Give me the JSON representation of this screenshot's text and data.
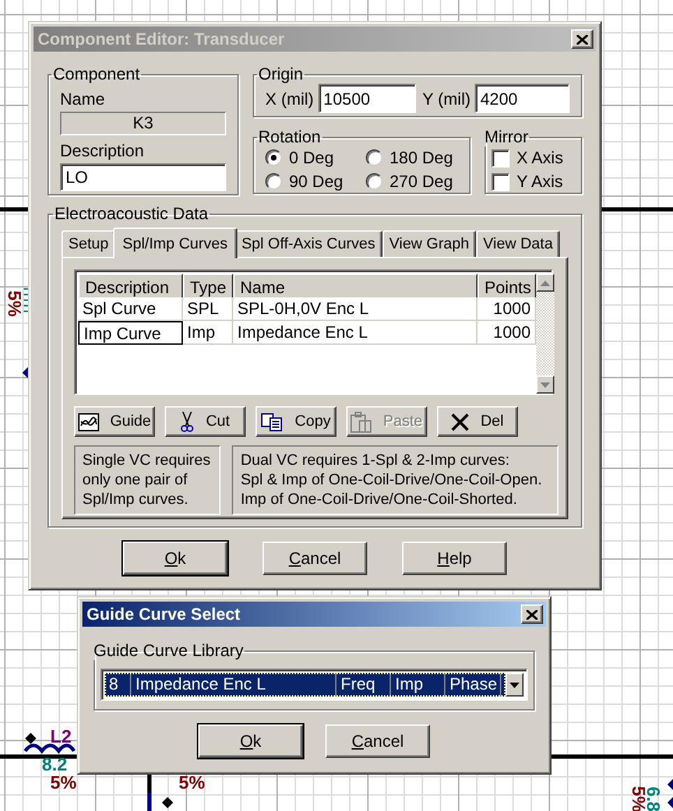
{
  "canvas": {
    "labels": [
      {
        "text": "5%",
        "kind": "vertical",
        "color": "#800000"
      },
      {
        "text": "L2",
        "kind": "part",
        "color": "#800080"
      },
      {
        "text": "8.2",
        "kind": "value",
        "color": "#008080"
      },
      {
        "text": "5%",
        "kind": "tolerance",
        "color": "#800000"
      },
      {
        "text": "5%",
        "kind": "tolerance2",
        "color": "#800000"
      },
      {
        "text": "5%",
        "kind": "vertical-right",
        "color": "#800000"
      },
      {
        "text": "6.8",
        "kind": "vertical-right2",
        "color": "#008080"
      }
    ]
  },
  "editor": {
    "title": "Component Editor: Transducer",
    "active": false,
    "component": {
      "legend": "Component",
      "name_label": "Name",
      "name_value": "K3",
      "description_label": "Description",
      "description_value": "LO"
    },
    "origin": {
      "legend": "Origin",
      "x_label": "X (mil)",
      "x_value": "10500",
      "y_label": "Y (mil)",
      "y_value": "4200"
    },
    "rotation": {
      "legend": "Rotation",
      "options": [
        {
          "label": "0 Deg",
          "selected": true
        },
        {
          "label": "180 Deg",
          "selected": false
        },
        {
          "label": "90 Deg",
          "selected": false
        },
        {
          "label": "270 Deg",
          "selected": false
        }
      ]
    },
    "mirror": {
      "legend": "Mirror",
      "options": [
        {
          "label": "X Axis",
          "checked": false
        },
        {
          "label": "Y Axis",
          "checked": false
        }
      ]
    },
    "data": {
      "legend": "Electroacoustic Data",
      "tabs": [
        {
          "label": "Setup",
          "selected": false
        },
        {
          "label": "Spl/Imp Curves",
          "selected": true
        },
        {
          "label": "Spl Off-Axis Curves",
          "selected": false
        },
        {
          "label": "View Graph",
          "selected": false
        },
        {
          "label": "View Data",
          "selected": false
        }
      ],
      "table": {
        "columns": [
          "Description",
          "Type",
          "Name",
          "Points"
        ],
        "rows": [
          {
            "cells": [
              "Spl Curve",
              "SPL",
              "SPL-0H,0V Enc L",
              "1000"
            ],
            "focused": false
          },
          {
            "cells": [
              "Imp Curve",
              "Imp",
              "Impedance Enc L",
              "1000"
            ],
            "focused": true
          }
        ]
      },
      "tools": [
        {
          "label": "Guide",
          "kind": "guide",
          "disabled": false
        },
        {
          "label": "Cut",
          "kind": "cut",
          "disabled": false
        },
        {
          "label": "Copy",
          "kind": "copy",
          "disabled": false
        },
        {
          "label": "Paste",
          "kind": "paste",
          "disabled": true
        },
        {
          "label": "Del",
          "kind": "delete",
          "disabled": false
        }
      ],
      "notes": [
        "Single VC requires\nonly one pair of\nSpl/Imp curves.",
        "Dual VC requires 1-Spl & 2-Imp curves:\nSpl & Imp of One-Coil-Drive/One-Coil-Open.\nImp of One-Coil-Drive/One-Coil-Shorted."
      ]
    },
    "buttons": [
      {
        "label": "Ok",
        "default": true
      },
      {
        "label": "Cancel",
        "default": false
      },
      {
        "label": "Help",
        "default": false
      }
    ]
  },
  "guide": {
    "title": "Guide Curve Select",
    "active": true,
    "legend": "Guide Curve Library",
    "selection": [
      "8",
      "Impedance Enc L",
      "Freq",
      "Imp",
      "Phase"
    ],
    "buttons": [
      {
        "label": "Ok",
        "default": true
      },
      {
        "label": "Cancel",
        "default": false
      }
    ]
  }
}
